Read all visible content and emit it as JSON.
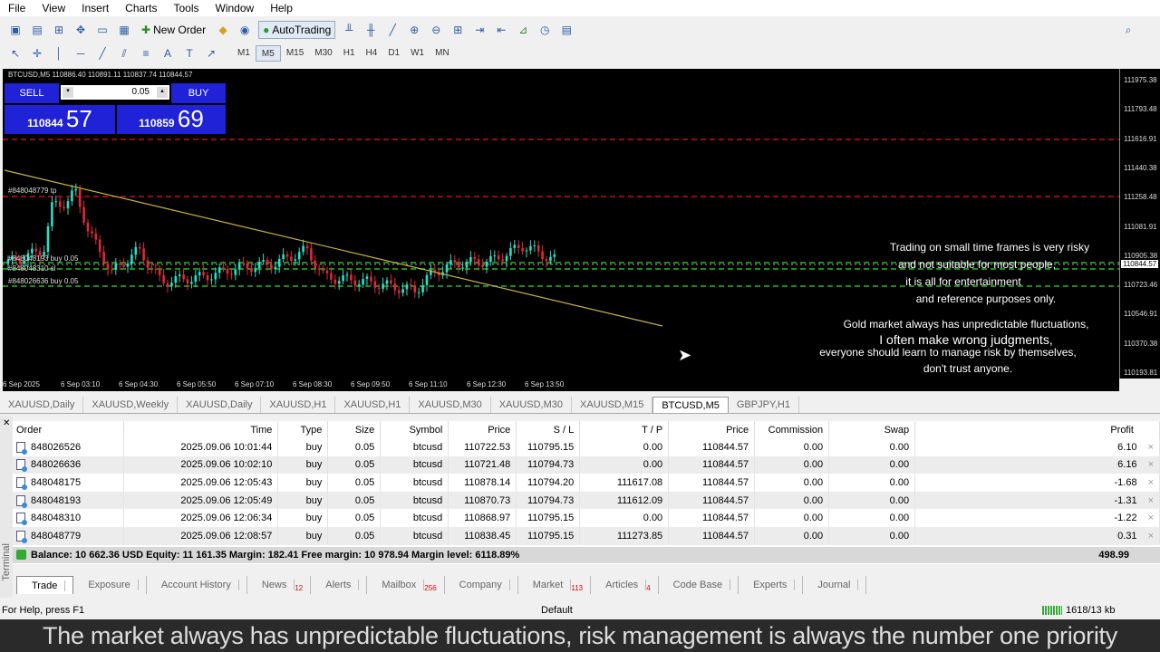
{
  "menu": [
    "File",
    "View",
    "Insert",
    "Charts",
    "Tools",
    "Window",
    "Help"
  ],
  "toolbar": {
    "new_order": "New Order",
    "autotrading": "AutoTrading"
  },
  "timeframes": [
    "M1",
    "M5",
    "M15",
    "M30",
    "H1",
    "H4",
    "D1",
    "W1",
    "MN"
  ],
  "active_timeframe": "M5",
  "chart": {
    "header": "BTCUSD,M5  110886.40 110891.11 110837.74 110844.57",
    "trade_panel": {
      "sell": "SELL",
      "buy": "BUY",
      "lot": "0.05",
      "sell_big": "110844",
      "sell_small": "57",
      "buy_big": "110859",
      "buy_small": "69"
    },
    "price_labels": [
      "111975.38",
      "111793.48",
      "111616.91",
      "111440.38",
      "111258.48",
      "111081.91",
      "110905.38",
      "110723.46",
      "110546.91",
      "110370.38",
      "110193.81"
    ],
    "current_price": "110844.57",
    "time_labels": [
      "6 Sep 2025",
      "6 Sep 03:10",
      "6 Sep 04:30",
      "6 Sep 05:50",
      "6 Sep 07:10",
      "6 Sep 08:30",
      "6 Sep 09:50",
      "6 Sep 11:10",
      "6 Sep 12:30",
      "6 Sep 13:50"
    ],
    "order_labels": [
      "#848048779 tp",
      "#848048193 buy 0.05",
      "#848048310 sl",
      "#848026636 buy 0.05"
    ],
    "notes": [
      "Trading on small time frames is very risky",
      "and not suitable for most people,",
      "it is all for entertainment",
      "and reference purposes only.",
      "Gold market always has unpredictable fluctuations,",
      "I often make wrong judgments,",
      "everyone should learn to manage risk by themselves,",
      "don't trust anyone."
    ],
    "colors": {
      "bull": "#26e0c8",
      "bear": "#e0283a",
      "trend": "#c8b040",
      "tp": "#c01020",
      "sl": "#20c020"
    }
  },
  "chart_tabs": [
    "XAUUSD,Daily",
    "XAUUSD,Weekly",
    "XAUUSD,Daily",
    "XAUUSD,H1",
    "XAUUSD,H1",
    "XAUUSD,M30",
    "XAUUSD,M30",
    "XAUUSD,M15",
    "BTCUSD,M5",
    "GBPJPY,H1"
  ],
  "active_chart_tab": 8,
  "terminal": {
    "columns": [
      "Order",
      "Time",
      "Type",
      "Size",
      "Symbol",
      "Price",
      "S / L",
      "T / P",
      "Price",
      "Commission",
      "Swap",
      "Profit"
    ],
    "rows": [
      [
        "848026526",
        "2025.09.06 10:01:44",
        "buy",
        "0.05",
        "btcusd",
        "110722.53",
        "110795.15",
        "0.00",
        "110844.57",
        "0.00",
        "0.00",
        "6.10"
      ],
      [
        "848026636",
        "2025.09.06 10:02:10",
        "buy",
        "0.05",
        "btcusd",
        "110721.48",
        "110794.73",
        "0.00",
        "110844.57",
        "0.00",
        "0.00",
        "6.16"
      ],
      [
        "848048175",
        "2025.09.06 12:05:43",
        "buy",
        "0.05",
        "btcusd",
        "110878.14",
        "110794.20",
        "111617.08",
        "110844.57",
        "0.00",
        "0.00",
        "-1.68"
      ],
      [
        "848048193",
        "2025.09.06 12:05:49",
        "buy",
        "0.05",
        "btcusd",
        "110870.73",
        "110794.73",
        "111612.09",
        "110844.57",
        "0.00",
        "0.00",
        "-1.31"
      ],
      [
        "848048310",
        "2025.09.06 12:06:34",
        "buy",
        "0.05",
        "btcusd",
        "110868.97",
        "110795.15",
        "0.00",
        "110844.57",
        "0.00",
        "0.00",
        "-1.22"
      ],
      [
        "848048779",
        "2025.09.06 12:08:57",
        "buy",
        "0.05",
        "btcusd",
        "110838.45",
        "110795.15",
        "111273.85",
        "110844.57",
        "0.00",
        "0.00",
        "0.31"
      ]
    ],
    "balance": "Balance: 10 662.36 USD  Equity: 11 161.35  Margin: 182.41  Free margin: 10 978.94  Margin level: 6118.89%",
    "total_profit": "498.99",
    "side_label": "Terminal",
    "tabs": [
      {
        "label": "Trade",
        "badge": ""
      },
      {
        "label": "Exposure",
        "badge": ""
      },
      {
        "label": "Account History",
        "badge": ""
      },
      {
        "label": "News",
        "badge": "12"
      },
      {
        "label": "Alerts",
        "badge": ""
      },
      {
        "label": "Mailbox",
        "badge": "256"
      },
      {
        "label": "Company",
        "badge": ""
      },
      {
        "label": "Market",
        "badge": "113"
      },
      {
        "label": "Articles",
        "badge": "4"
      },
      {
        "label": "Code Base",
        "badge": ""
      },
      {
        "label": "Experts",
        "badge": ""
      },
      {
        "label": "Journal",
        "badge": ""
      }
    ]
  },
  "status": {
    "help": "For Help, press F1",
    "profile": "Default",
    "traffic": "1618/13 kb"
  },
  "subtitle": "The market always has unpredictable fluctuations, risk management is always the number one priority"
}
